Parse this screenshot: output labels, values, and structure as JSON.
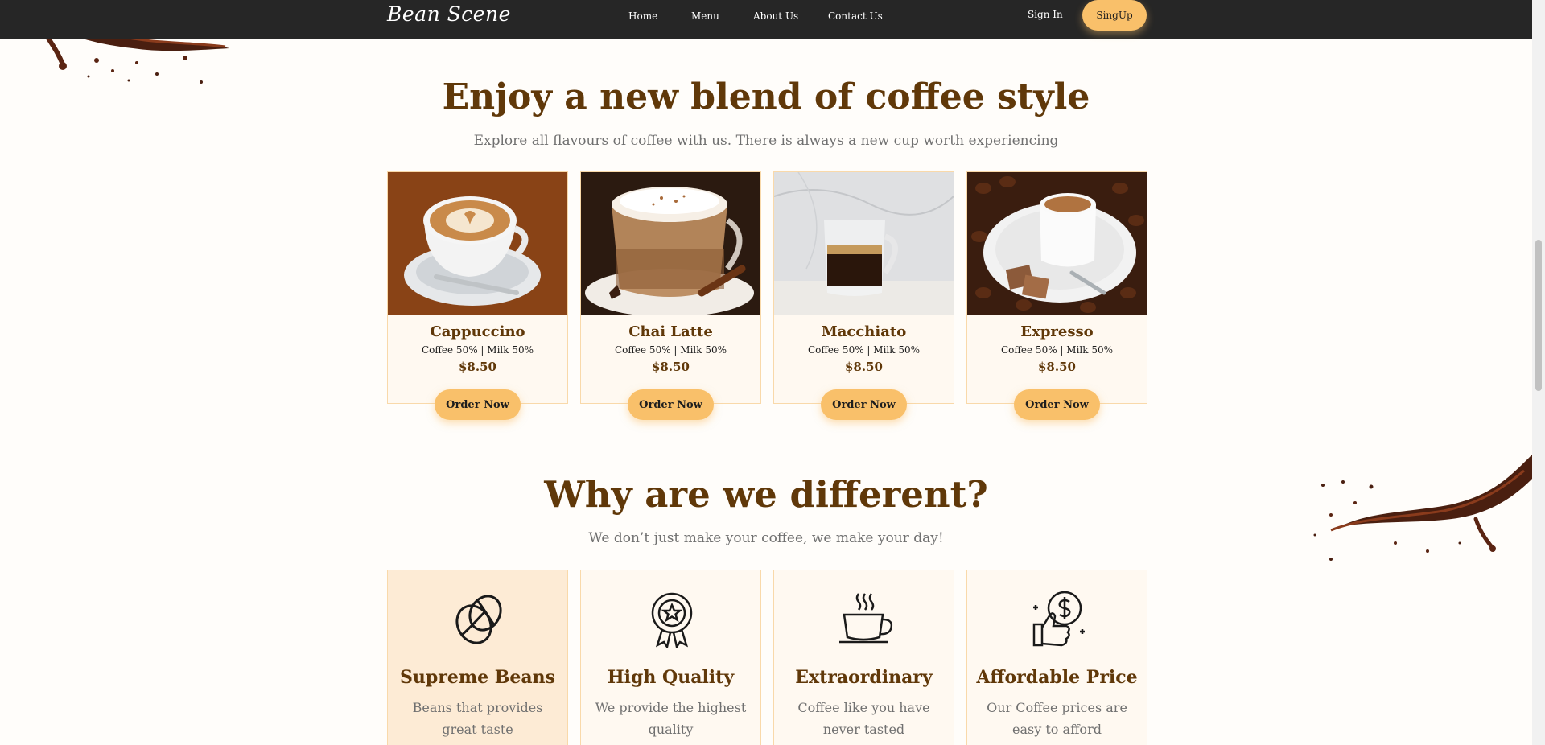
{
  "nav": {
    "brand": "Bean Scene",
    "links": [
      "Home",
      "Menu",
      "About Us",
      "Contact Us"
    ],
    "sign_in": "Sign In",
    "sign_up": "SingUp"
  },
  "products_section": {
    "title": "Enjoy a new blend of coffee style",
    "subtitle": "Explore all flavours of coffee with us. There is always a new cup worth experiencing",
    "items": [
      {
        "name": "Cappuccino",
        "desc": "Coffee 50% | Milk 50%",
        "price": "$8.50",
        "button": "Order Now"
      },
      {
        "name": "Chai Latte",
        "desc": "Coffee 50% | Milk 50%",
        "price": "$8.50",
        "button": "Order Now"
      },
      {
        "name": "Macchiato",
        "desc": "Coffee 50% | Milk 50%",
        "price": "$8.50",
        "button": "Order Now"
      },
      {
        "name": "Expresso",
        "desc": "Coffee 50% | Milk 50%",
        "price": "$8.50",
        "button": "Order Now"
      }
    ]
  },
  "features_section": {
    "title": "Why are we different?",
    "subtitle": "We don’t just make your coffee, we make your day!",
    "items": [
      {
        "icon": "coffee-bean-icon",
        "title": "Supreme Beans",
        "desc": "Beans that provides great taste"
      },
      {
        "icon": "award-badge-icon",
        "title": "High Quality",
        "desc": "We provide the highest quality"
      },
      {
        "icon": "coffee-cup-icon",
        "title": "Extraordinary",
        "desc": "Coffee like you have never tasted"
      },
      {
        "icon": "thumbs-up-dollar-icon",
        "title": "Affordable Price",
        "desc": "Our Coffee prices are easy to afford"
      }
    ]
  },
  "colors": {
    "navbar": "#262626",
    "accent": "#f9c06a",
    "heading": "#603809",
    "card_bg": "#fff9f1",
    "card_border": "#f9d9aa"
  }
}
